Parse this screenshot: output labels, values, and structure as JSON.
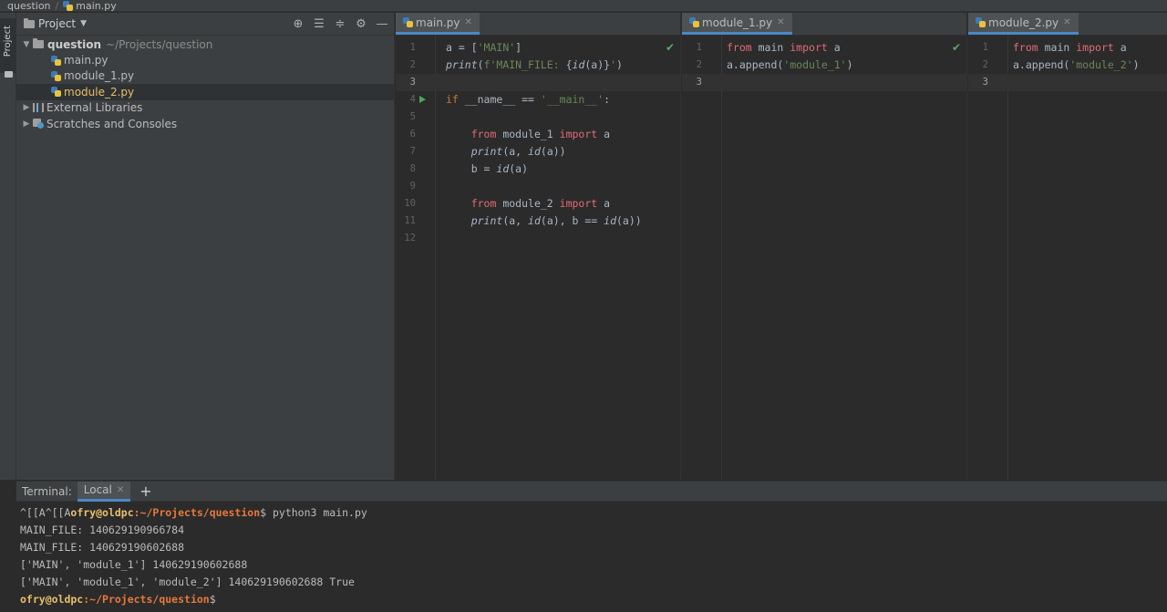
{
  "breadcrumb": {
    "project": "question",
    "file": "main.py"
  },
  "tool_strip": {
    "project_tab": "Project"
  },
  "project_panel": {
    "title": "Project",
    "tools": [
      "locate-icon",
      "expand-all-icon",
      "collapse-all-icon",
      "gear-icon",
      "minimize-icon"
    ],
    "tree": {
      "root": {
        "name": "question",
        "path": "~/Projects/question"
      },
      "files": [
        "main.py",
        "module_1.py",
        "module_2.py"
      ],
      "external_libraries": "External Libraries",
      "scratches": "Scratches and Consoles"
    }
  },
  "editors": {
    "main": {
      "tab": "main.py",
      "lines": [
        {
          "n": "1",
          "parts": [
            [
              "plain",
              "a = ["
            ],
            [
              "str",
              "'MAIN'"
            ],
            [
              "plain",
              "]"
            ]
          ]
        },
        {
          "n": "2",
          "parts": [
            [
              "fni",
              "print"
            ],
            [
              "plain",
              "("
            ],
            [
              "str",
              "f'MAIN_FILE: "
            ],
            [
              "plain",
              "{"
            ],
            [
              "fni",
              "id"
            ],
            [
              "plain",
              "(a)}"
            ],
            [
              "str",
              "'"
            ],
            [
              "plain",
              ")"
            ]
          ]
        },
        {
          "n": "3",
          "parts": []
        },
        {
          "n": "4",
          "parts": [
            [
              "kw",
              "if"
            ],
            [
              "plain",
              " __name__ == "
            ],
            [
              "str",
              "'__main__'"
            ],
            [
              "plain",
              ":"
            ]
          ]
        },
        {
          "n": "5",
          "parts": []
        },
        {
          "n": "6",
          "parts": [
            [
              "plain",
              "    "
            ],
            [
              "kw2",
              "from"
            ],
            [
              "plain",
              " module_1 "
            ],
            [
              "kw2",
              "import"
            ],
            [
              "plain",
              " a"
            ]
          ]
        },
        {
          "n": "7",
          "parts": [
            [
              "plain",
              "    "
            ],
            [
              "fni",
              "print"
            ],
            [
              "plain",
              "(a, "
            ],
            [
              "fni",
              "id"
            ],
            [
              "plain",
              "(a))"
            ]
          ]
        },
        {
          "n": "8",
          "parts": [
            [
              "plain",
              "    b = "
            ],
            [
              "fni",
              "id"
            ],
            [
              "plain",
              "(a)"
            ]
          ]
        },
        {
          "n": "9",
          "parts": []
        },
        {
          "n": "10",
          "parts": [
            [
              "plain",
              "    "
            ],
            [
              "kw2",
              "from"
            ],
            [
              "plain",
              " module_2 "
            ],
            [
              "kw2",
              "import"
            ],
            [
              "plain",
              " a"
            ]
          ]
        },
        {
          "n": "11",
          "parts": [
            [
              "plain",
              "    "
            ],
            [
              "fni",
              "print"
            ],
            [
              "plain",
              "(a, "
            ],
            [
              "fni",
              "id"
            ],
            [
              "plain",
              "(a), b == "
            ],
            [
              "fni",
              "id"
            ],
            [
              "plain",
              "(a))"
            ]
          ]
        },
        {
          "n": "12",
          "parts": []
        }
      ]
    },
    "module_1": {
      "tab": "module_1.py",
      "lines": [
        {
          "n": "1",
          "parts": [
            [
              "kw2",
              "from"
            ],
            [
              "plain",
              " main "
            ],
            [
              "kw2",
              "import"
            ],
            [
              "plain",
              " a"
            ]
          ]
        },
        {
          "n": "2",
          "parts": [
            [
              "plain",
              "a.append("
            ],
            [
              "str",
              "'module_1'"
            ],
            [
              "plain",
              ")"
            ]
          ]
        },
        {
          "n": "3",
          "parts": []
        }
      ]
    },
    "module_2": {
      "tab": "module_2.py",
      "lines": [
        {
          "n": "1",
          "parts": [
            [
              "kw2",
              "from"
            ],
            [
              "plain",
              " main "
            ],
            [
              "kw2",
              "import"
            ],
            [
              "plain",
              " a"
            ]
          ]
        },
        {
          "n": "2",
          "parts": [
            [
              "plain",
              "a.append("
            ],
            [
              "str",
              "'module_2'"
            ],
            [
              "plain",
              ")"
            ]
          ]
        },
        {
          "n": "3",
          "parts": []
        }
      ]
    }
  },
  "terminal": {
    "label": "Terminal:",
    "tab": "Local",
    "lines": [
      {
        "prefix": "^[[A^[[A",
        "user": "ofry@oldpc",
        "path": ":~/Projects/question",
        "cmd": "$ python3 main.py"
      },
      {
        "text": "MAIN_FILE: 140629190966784"
      },
      {
        "text": "MAIN_FILE: 140629190602688"
      },
      {
        "text": "['MAIN', 'module_1'] 140629190602688"
      },
      {
        "text": "['MAIN', 'module_1', 'module_2'] 140629190602688 True"
      },
      {
        "prefix": "",
        "user": "ofry@oldpc",
        "path": ":~/Projects/question",
        "cmd": "$"
      }
    ]
  }
}
